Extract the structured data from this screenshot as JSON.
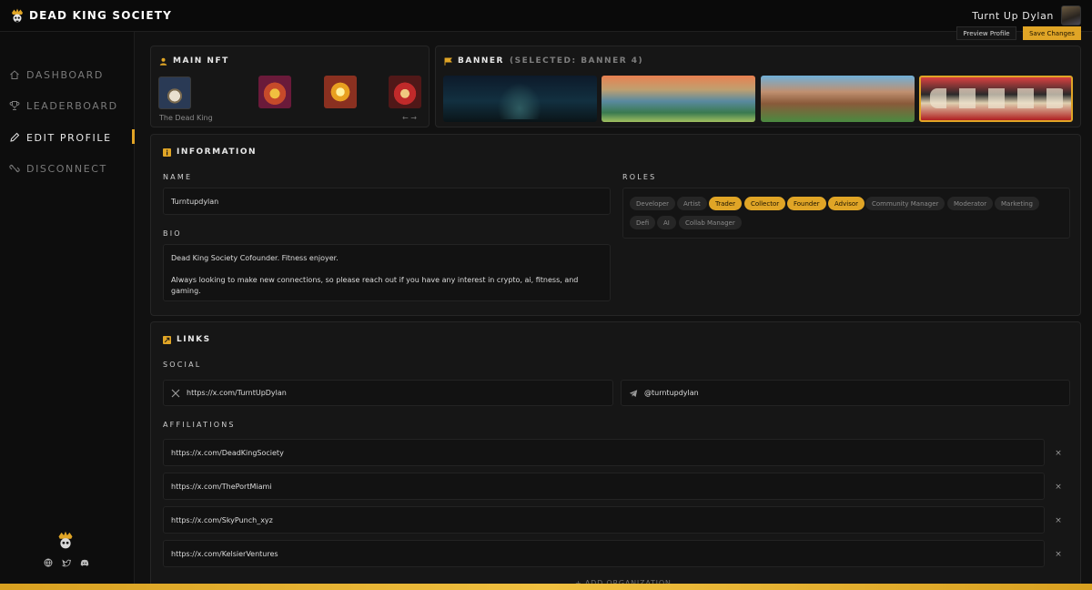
{
  "app": {
    "brand": "DEAD KING SOCIETY",
    "user_name": "Turnt Up Dylan"
  },
  "sidebar": {
    "items": [
      {
        "label": "DASHBOARD",
        "icon": "home-icon",
        "active": false
      },
      {
        "label": "LEADERBOARD",
        "icon": "trophy-icon",
        "active": false
      },
      {
        "label": "EDIT PROFILE",
        "icon": "pencil-icon",
        "active": true
      },
      {
        "label": "DISCONNECT",
        "icon": "unlink-icon",
        "active": false
      }
    ],
    "footer_icons": [
      "globe-icon",
      "twitter-icon",
      "discord-icon"
    ]
  },
  "toolbar": {
    "preview_label": "Preview Profile",
    "save_label": "Save Changes"
  },
  "main_nft": {
    "title": "MAIN NFT",
    "selected_name": "The Dead King",
    "nav_arrows": "← →"
  },
  "banner": {
    "title": "BANNER",
    "selected_note": "(SELECTED: BANNER 4)",
    "selected_index": 4
  },
  "information": {
    "title": "INFORMATION",
    "name_label": "NAME",
    "name_value": "Turntupdylan",
    "bio_label": "BIO",
    "bio_line1": "Dead King Society Cofounder. Fitness enjoyer.",
    "bio_line2": "Always looking to make new connections, so please reach out if you have any interest in crypto, ai, fitness, and gaming.",
    "roles_label": "ROLES",
    "roles": [
      {
        "label": "Developer",
        "selected": false
      },
      {
        "label": "Artist",
        "selected": false
      },
      {
        "label": "Trader",
        "selected": true
      },
      {
        "label": "Collector",
        "selected": true
      },
      {
        "label": "Founder",
        "selected": true
      },
      {
        "label": "Advisor",
        "selected": true
      },
      {
        "label": "Community Manager",
        "selected": false
      },
      {
        "label": "Moderator",
        "selected": false
      },
      {
        "label": "Marketing",
        "selected": false
      },
      {
        "label": "Defi",
        "selected": false
      },
      {
        "label": "AI",
        "selected": false
      },
      {
        "label": "Collab Manager",
        "selected": false
      }
    ]
  },
  "links": {
    "title": "LINKS",
    "social_label": "SOCIAL",
    "x_url": "https://x.com/TurntUpDylan",
    "telegram": "@turntupdylan",
    "affiliations_label": "AFFILIATIONS",
    "affiliations": [
      "https://x.com/DeadKingSociety",
      "https://x.com/ThePortMiami",
      "https://x.com/SkyPunch_xyz",
      "https://x.com/KelsierVentures"
    ],
    "remove_symbol": "×",
    "add_org_label": "+ ADD ORGANIZATION"
  },
  "colors": {
    "accent": "#e0a526",
    "background": "#111111",
    "panel": "#161616"
  }
}
